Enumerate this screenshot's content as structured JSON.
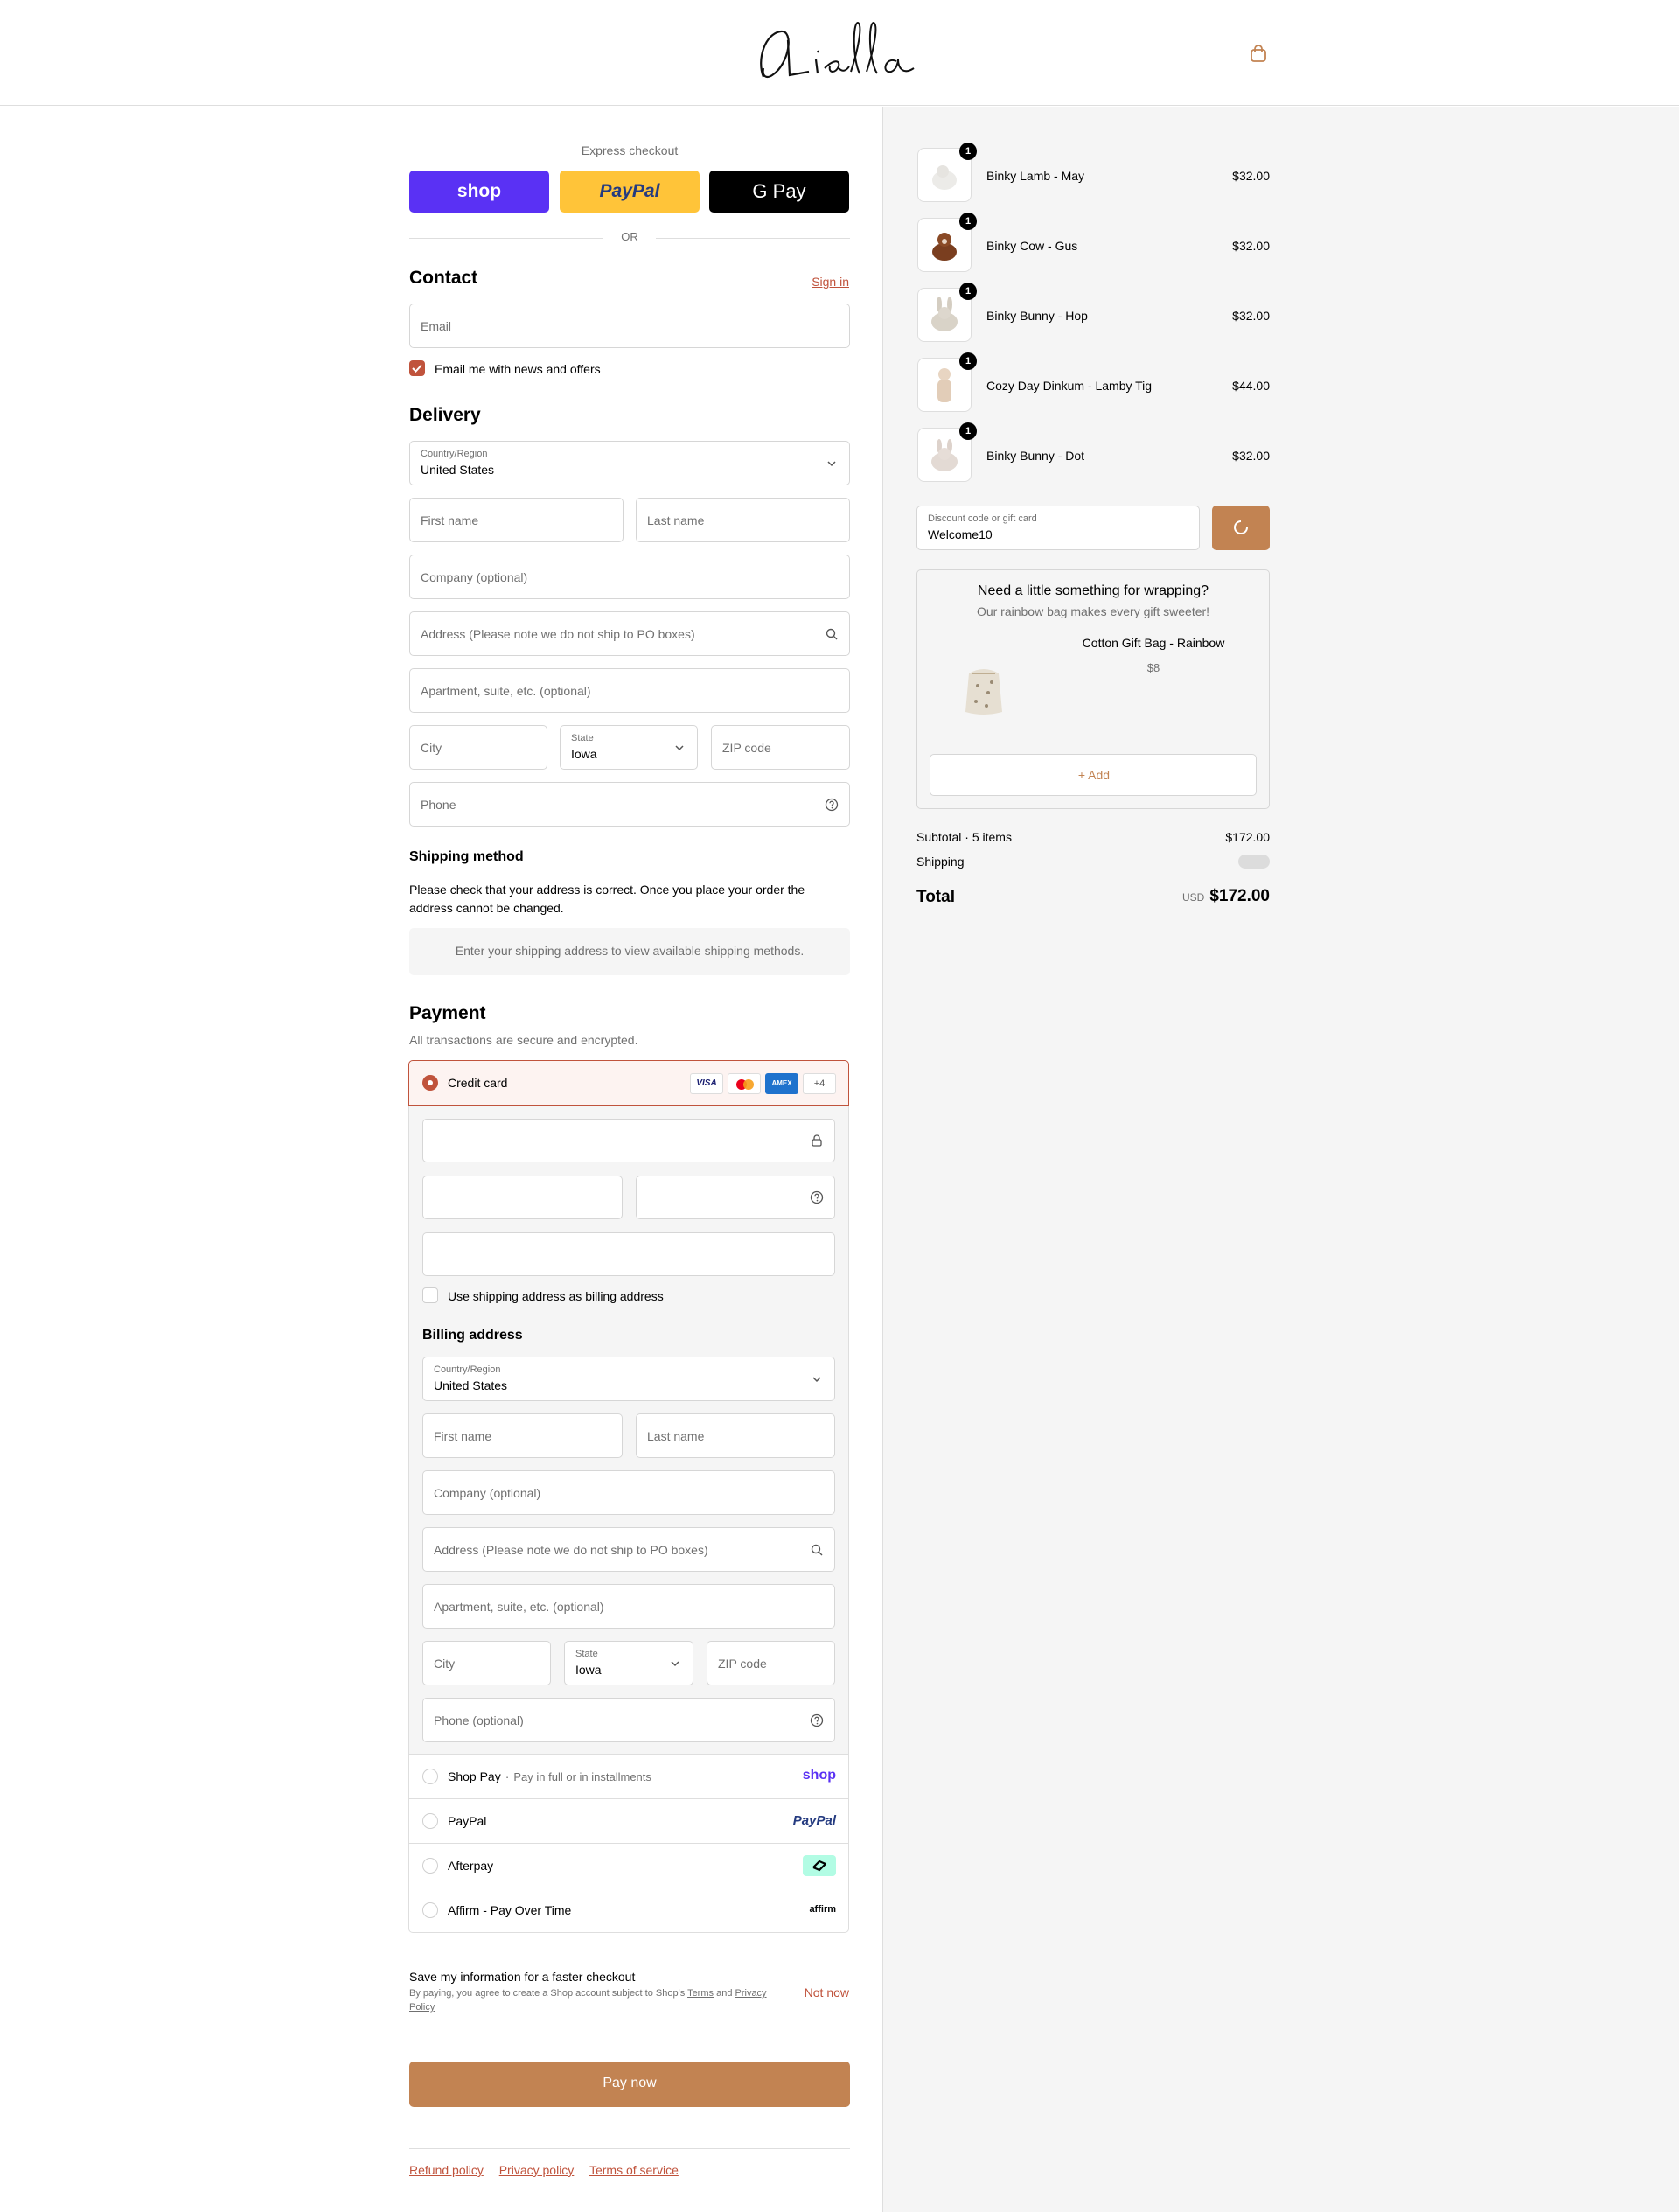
{
  "brand": {
    "name": "Olliella",
    "accent": "#c28352",
    "link_color": "#c0533c"
  },
  "header": {
    "cart_icon": "shopping-bag-icon"
  },
  "express": {
    "title": "Express checkout",
    "shop_label": "shop",
    "paypal_label": "PayPal",
    "gpay_label": "G Pay",
    "or_label": "OR"
  },
  "contact": {
    "heading": "Contact",
    "sign_in": "Sign in",
    "email_placeholder": "Email",
    "newsletter_label": "Email me with news and offers",
    "newsletter_checked": true
  },
  "delivery": {
    "heading": "Delivery",
    "country_label": "Country/Region",
    "country_value": "United States",
    "first_name": "First name",
    "last_name": "Last name",
    "company": "Company (optional)",
    "address": "Address (Please note we do not ship to PO boxes)",
    "apartment": "Apartment, suite, etc. (optional)",
    "city": "City",
    "state_label": "State",
    "state_value": "Iowa",
    "zip": "ZIP code",
    "phone": "Phone"
  },
  "shipping_method": {
    "heading": "Shipping method",
    "note": "Please check that your address is correct. Once you place your order the address cannot be changed.",
    "empty_message": "Enter your shipping address to view available shipping methods."
  },
  "payment": {
    "heading": "Payment",
    "subtitle": "All transactions are secure and encrypted.",
    "credit_card_label": "Credit card",
    "card_more": "+4",
    "use_shipping_label": "Use shipping address as billing address",
    "billing_heading": "Billing address",
    "billing": {
      "country_label": "Country/Region",
      "country_value": "United States",
      "first_name": "First name",
      "last_name": "Last name",
      "company": "Company (optional)",
      "address": "Address (Please note we do not ship to PO boxes)",
      "apartment": "Apartment, suite, etc. (optional)",
      "city": "City",
      "state_label": "State",
      "state_value": "Iowa",
      "zip": "ZIP code",
      "phone": "Phone (optional)"
    },
    "methods": [
      {
        "label": "Shop Pay",
        "sub": "Pay in full or in installments",
        "logo": "shop"
      },
      {
        "label": "PayPal",
        "logo": "PayPal"
      },
      {
        "label": "Afterpay",
        "logo": "afterpay-icon"
      },
      {
        "label": "Affirm - Pay Over Time",
        "logo": "affirm"
      }
    ]
  },
  "save_info": {
    "title": "Save my information for a faster checkout",
    "desc_prefix": "By paying, you agree to create a Shop account subject to Shop's",
    "terms": "Terms",
    "and": "and",
    "privacy": "Privacy Policy",
    "not_now": "Not now"
  },
  "pay_now": "Pay now",
  "footer_links": [
    "Refund policy",
    "Privacy policy",
    "Terms of service"
  ],
  "cart": {
    "items": [
      {
        "name": "Binky Lamb - May",
        "price": "$32.00",
        "qty": "1"
      },
      {
        "name": "Binky Cow - Gus",
        "price": "$32.00",
        "qty": "1"
      },
      {
        "name": "Binky Bunny - Hop",
        "price": "$32.00",
        "qty": "1"
      },
      {
        "name": "Cozy Day Dinkum - Lamby Tig",
        "price": "$44.00",
        "qty": "1"
      },
      {
        "name": "Binky Bunny - Dot",
        "price": "$32.00",
        "qty": "1"
      }
    ],
    "discount_label": "Discount code or gift card",
    "discount_value": "Welcome10",
    "upsell": {
      "title": "Need a little something for wrapping?",
      "subtitle": "Our rainbow bag makes every gift sweeter!",
      "product": "Cotton Gift Bag - Rainbow",
      "price": "$8",
      "add_label": "+ Add"
    },
    "subtotal_label": "Subtotal · 5 items",
    "subtotal_value": "$172.00",
    "shipping_label": "Shipping",
    "total_label": "Total",
    "currency": "USD",
    "total_value": "$172.00"
  }
}
